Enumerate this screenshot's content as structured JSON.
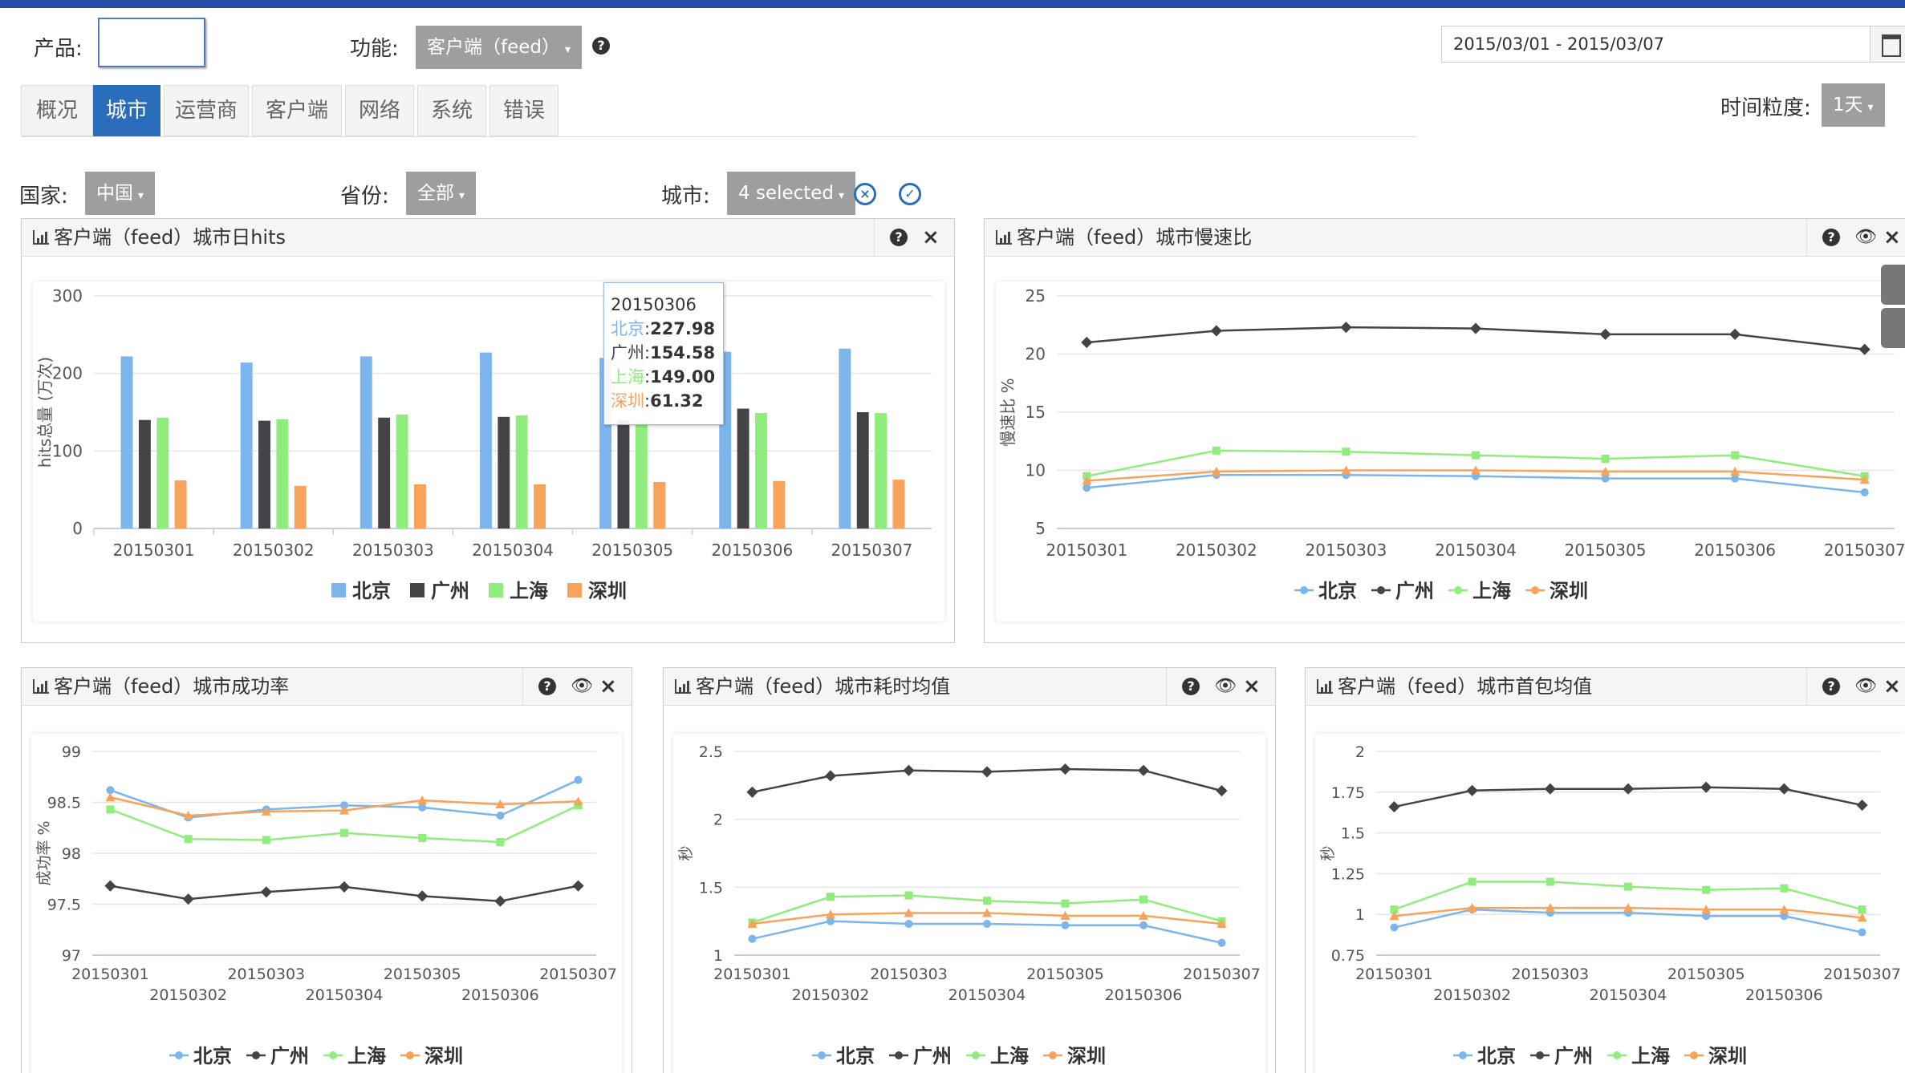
{
  "filters": {
    "product_label": "产品:",
    "feature_label": "功能:",
    "feature_value": "客户端（feed）",
    "date_range": "2015/03/01 - 2015/03/07",
    "granularity_label": "时间粒度:",
    "granularity_value": "1天",
    "country_label": "国家:",
    "country_value": "中国",
    "province_label": "省份:",
    "province_value": "全部",
    "city_label": "城市:",
    "city_value": "4 selected"
  },
  "tabs": [
    {
      "label": "概况"
    },
    {
      "label": "城市"
    },
    {
      "label": "运营商"
    },
    {
      "label": "客户端"
    },
    {
      "label": "网络"
    },
    {
      "label": "系统"
    },
    {
      "label": "错误"
    }
  ],
  "active_tab": 1,
  "panels": {
    "hits_title": "客户端（feed）城市日hits",
    "slow_title": "客户端（feed）城市慢速比",
    "success_title": "客户端（feed）城市成功率",
    "latency_title": "客户端（feed）城市耗时均值",
    "firstpkg_title": "客户端（feed）城市首包均值"
  },
  "tooltip": {
    "date": "20150306",
    "rows": [
      {
        "city": "北京",
        "value": "227.98"
      },
      {
        "city": "广州",
        "value": "154.58"
      },
      {
        "city": "上海",
        "value": "149.00"
      },
      {
        "city": "深圳",
        "value": "61.32"
      }
    ]
  },
  "colors": {
    "北京": "#7cb5ec",
    "广州": "#434348",
    "上海": "#90ed7d",
    "深圳": "#f7a35c"
  },
  "chart_data": [
    {
      "type": "bar",
      "title": "客户端（feed）城市日hits",
      "ylabel": "hits总量 (万次)",
      "ylim": [
        0,
        300
      ],
      "yticks": [
        0,
        100,
        200,
        300
      ],
      "categories": [
        "20150301",
        "20150302",
        "20150303",
        "20150304",
        "20150305",
        "20150306",
        "20150307"
      ],
      "series": [
        {
          "name": "北京",
          "values": [
            222,
            214,
            222,
            227,
            220,
            227.98,
            232
          ]
        },
        {
          "name": "广州",
          "values": [
            140,
            139,
            143,
            144,
            140,
            154.58,
            150
          ]
        },
        {
          "name": "上海",
          "values": [
            143,
            141,
            147,
            146,
            140,
            149.0,
            149
          ]
        },
        {
          "name": "深圳",
          "values": [
            62,
            55,
            57,
            57,
            60,
            61.32,
            63
          ]
        }
      ],
      "legend": "bottom-center"
    },
    {
      "type": "line",
      "title": "客户端（feed）城市慢速比",
      "ylabel": "慢速比 %",
      "ylim": [
        5,
        25
      ],
      "yticks": [
        5,
        10,
        15,
        20,
        25
      ],
      "categories": [
        "20150301",
        "20150302",
        "20150303",
        "20150304",
        "20150305",
        "20150306",
        "20150307"
      ],
      "series": [
        {
          "name": "北京",
          "values": [
            8.5,
            9.6,
            9.6,
            9.5,
            9.3,
            9.3,
            8.1
          ]
        },
        {
          "name": "广州",
          "values": [
            21.0,
            22.0,
            22.3,
            22.2,
            21.7,
            21.7,
            20.4
          ]
        },
        {
          "name": "上海",
          "values": [
            9.5,
            11.7,
            11.6,
            11.3,
            11.0,
            11.3,
            9.5
          ]
        },
        {
          "name": "深圳",
          "values": [
            9.1,
            9.9,
            10.0,
            10.0,
            9.9,
            9.9,
            9.2
          ]
        }
      ],
      "legend": "bottom-center"
    },
    {
      "type": "line",
      "title": "客户端（feed）城市成功率",
      "ylabel": "成功率 %",
      "ylim": [
        97,
        99
      ],
      "yticks": [
        97,
        97.5,
        98,
        98.5,
        99
      ],
      "categories": [
        "20150301",
        "20150302",
        "20150303",
        "20150304",
        "20150305",
        "20150306",
        "20150307"
      ],
      "series": [
        {
          "name": "北京",
          "values": [
            98.62,
            98.35,
            98.43,
            98.47,
            98.45,
            98.37,
            98.72
          ]
        },
        {
          "name": "广州",
          "values": [
            97.68,
            97.55,
            97.62,
            97.67,
            97.58,
            97.53,
            97.68
          ]
        },
        {
          "name": "上海",
          "values": [
            98.43,
            98.14,
            98.13,
            98.2,
            98.15,
            98.11,
            98.47
          ]
        },
        {
          "name": "深圳",
          "values": [
            98.55,
            98.37,
            98.41,
            98.42,
            98.52,
            98.48,
            98.51
          ]
        }
      ],
      "legend": "bottom-center"
    },
    {
      "type": "line",
      "title": "客户端（feed）城市耗时均值",
      "ylabel": "秒",
      "ylim": [
        1,
        2.5
      ],
      "yticks": [
        1,
        1.5,
        2,
        2.5
      ],
      "categories": [
        "20150301",
        "20150302",
        "20150303",
        "20150304",
        "20150305",
        "20150306",
        "20150307"
      ],
      "series": [
        {
          "name": "北京",
          "values": [
            1.12,
            1.25,
            1.23,
            1.23,
            1.22,
            1.22,
            1.09
          ]
        },
        {
          "name": "广州",
          "values": [
            2.2,
            2.32,
            2.36,
            2.35,
            2.37,
            2.36,
            2.21
          ]
        },
        {
          "name": "上海",
          "values": [
            1.24,
            1.43,
            1.44,
            1.4,
            1.38,
            1.41,
            1.25
          ]
        },
        {
          "name": "深圳",
          "values": [
            1.23,
            1.3,
            1.31,
            1.31,
            1.29,
            1.29,
            1.23
          ]
        }
      ],
      "legend": "bottom-center"
    },
    {
      "type": "line",
      "title": "客户端（feed）城市首包均值",
      "ylabel": "秒",
      "ylim": [
        0.75,
        2
      ],
      "yticks": [
        0.75,
        1,
        1.25,
        1.5,
        1.75,
        2
      ],
      "categories": [
        "20150301",
        "20150302",
        "20150303",
        "20150304",
        "20150305",
        "20150306",
        "20150307"
      ],
      "series": [
        {
          "name": "北京",
          "values": [
            0.92,
            1.03,
            1.01,
            1.01,
            0.99,
            0.99,
            0.89
          ]
        },
        {
          "name": "广州",
          "values": [
            1.66,
            1.76,
            1.77,
            1.77,
            1.78,
            1.77,
            1.67
          ]
        },
        {
          "name": "上海",
          "values": [
            1.03,
            1.2,
            1.2,
            1.17,
            1.15,
            1.16,
            1.03
          ]
        },
        {
          "name": "深圳",
          "values": [
            0.99,
            1.04,
            1.04,
            1.04,
            1.03,
            1.03,
            0.98
          ]
        }
      ],
      "legend": "bottom-center"
    }
  ]
}
